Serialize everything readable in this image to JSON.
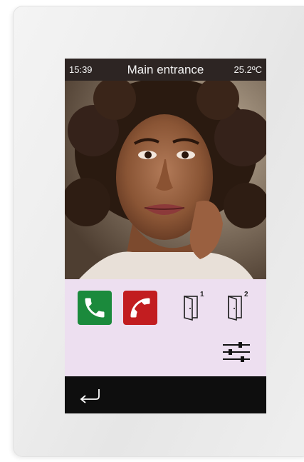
{
  "statusbar": {
    "time": "15:39",
    "title": "Main entrance",
    "temperature": "25.2ºC"
  },
  "controls": {
    "accept_icon": "phone-accept-icon",
    "reject_icon": "phone-reject-icon",
    "door1_label": "1",
    "door2_label": "2",
    "settings_icon": "sliders-icon"
  },
  "navigation": {
    "back_icon": "back-arrow-icon"
  },
  "colors": {
    "accept": "#1b8a3c",
    "reject": "#c21d20",
    "controls_background": "#eddff0",
    "statusbar_background": "#2d2523"
  }
}
